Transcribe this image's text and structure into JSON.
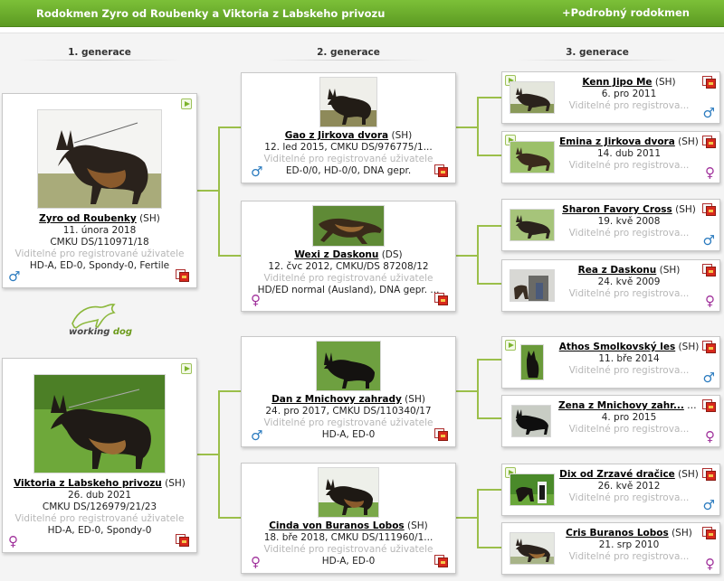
{
  "header": {
    "title": "Rodokmen Zyro od Roubenky a Viktoria z Labskeho privozu",
    "detail_link": "+Podrobný rodokmen"
  },
  "generations": [
    "1. generace",
    "2. generace",
    "3. generace"
  ],
  "logo": {
    "word1": "working",
    "word2": "dog"
  },
  "gen1": [
    {
      "name": "Zyro od Roubenky",
      "title": " (SH)",
      "born": "11. února 2018",
      "reg": "CMKU DS/110971/18",
      "visibility": "Viditelné pro registrované uživatele",
      "health": "HD-A, ED-0, Spondy-0, Fertile",
      "sex": "♂"
    },
    {
      "name": "Viktoria z Labskeho privozu",
      "title": " (SH)",
      "born": "26. dub 2021",
      "reg": "CMKU DS/126979/21/23",
      "visibility": "Viditelné pro registrované uživatele",
      "health": "HD-A, ED-0, Spondy-0",
      "sex": "♀"
    }
  ],
  "gen2": [
    {
      "name": "Gao z Jirkova dvora",
      "title": " (SH)",
      "info": "12. led 2015, CMKU DS/976775/1...",
      "visibility": "Viditelné pro registrované uživatele",
      "health": "ED-0/0, HD-0/0, DNA gepr.",
      "sex": "♂"
    },
    {
      "name": "Wexi z Daskonu",
      "title": " (DS)",
      "info": "12. čvc 2012, CMKU/DS 87208/12",
      "visibility": "Viditelné pro registrované uživatele",
      "health": "HD/ED normal (Ausland), DNA gepr. ...",
      "sex": "♀"
    },
    {
      "name": "Dan z Mnichovy zahrady",
      "title": " (SH)",
      "info": "24. pro 2017, CMKU DS/110340/17",
      "visibility": "Viditelné pro registrované uživatele",
      "health": "HD-A, ED-0",
      "sex": "♂"
    },
    {
      "name": "Cinda von Buranos Lobos",
      "title": " (SH)",
      "info": "18. bře 2018, CMKU DS/111960/1...",
      "visibility": "Viditelné pro registrované uživatele",
      "health": "HD-A, ED-0",
      "sex": "♀"
    }
  ],
  "gen3": [
    {
      "name": "Kenn Jipo Me",
      "title": " (SH)",
      "born": "6. pro 2011",
      "visibility": "Viditelné pro registrova...",
      "sex": "♂"
    },
    {
      "name": "Emina z Jirkova dvora",
      "title": " (SH)",
      "born": "14. dub 2011",
      "visibility": "Viditelné pro registrova...",
      "sex": "♀"
    },
    {
      "name": "Sharon Favory Cross",
      "title": " (SH)",
      "born": "19. kvě 2008",
      "visibility": "Viditelné pro registrova...",
      "sex": "♂"
    },
    {
      "name": "Rea z Daskonu",
      "title": " (SH)",
      "born": "24. kvě 2009",
      "visibility": "Viditelné pro registrova...",
      "sex": "♀"
    },
    {
      "name": "Athos Smolkovský les",
      "title": " (SH)",
      "born": "11. bře 2014",
      "visibility": "Viditelné pro registrova...",
      "sex": "♂"
    },
    {
      "name": "Zena z Mnichovy zahr...",
      "title": " (SH)",
      "born": "4. pro 2015",
      "visibility": "Viditelné pro registrova...",
      "sex": "♀"
    },
    {
      "name": "Dix od Zrzavé dračice",
      "title": " (SH)",
      "born": "26. kvě 2012",
      "visibility": "Viditelné pro registrova...",
      "sex": "♂"
    },
    {
      "name": "Cris Buranos Lobos",
      "title": " (SH)",
      "born": "21. srp 2010",
      "visibility": "Viditelné pro registrova...",
      "sex": "♀"
    }
  ],
  "icons": {
    "play": "video-play-icon",
    "document": "pedigree-document-icon",
    "male": "male-sex-icon",
    "female": "female-sex-icon"
  },
  "colors": {
    "header": "#6aab2a",
    "connector": "#9bbf4a",
    "male": "#2b7bbf",
    "female": "#a0319b"
  }
}
